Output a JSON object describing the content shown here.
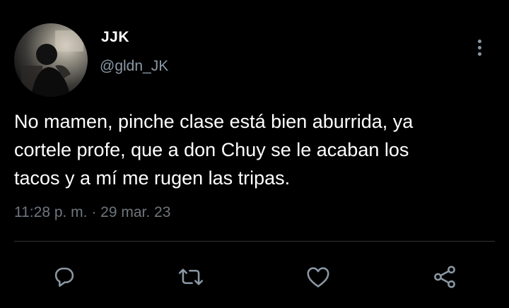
{
  "user": {
    "name": "JJK",
    "handle": "@gldn_JK"
  },
  "tweet": {
    "lines": [
      "No mamen, pinche clase está bien aburrida, ya",
      "cortele profe, que a don Chuy se le acaban los",
      "tacos y a mí me rugen las tripas."
    ],
    "timestamp": "11:28 p. m. · 29 mar. 23"
  },
  "icons": {
    "more": "more-vertical-icon",
    "reply": "reply-icon",
    "retweet": "retweet-icon",
    "like": "heart-icon",
    "share": "share-icon"
  },
  "colors": {
    "background": "#000000",
    "text": "#ffffff",
    "secondary": "#8b98a5",
    "divider": "#2f3336"
  }
}
